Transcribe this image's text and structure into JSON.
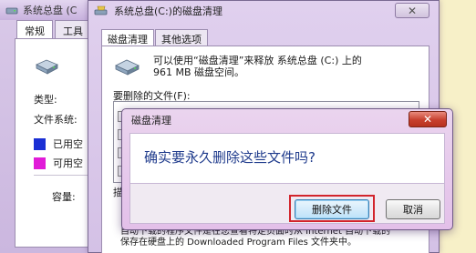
{
  "properties_window": {
    "title": "系统总盘 (C",
    "tabs": [
      {
        "label": "常规",
        "active": true
      },
      {
        "label": "工具",
        "active": false
      }
    ],
    "type_label": "类型:",
    "filesystem_label": "文件系统:",
    "used_label": "已用空",
    "free_label": "可用空",
    "capacity_label": "容量:",
    "used_color": "#1a2fd4",
    "free_color": "#e11bd8"
  },
  "disk_cleanup_window": {
    "title": "系统总盘(C:)的磁盘清理",
    "tabs": [
      {
        "label": "磁盘清理",
        "active": true
      },
      {
        "label": "其他选项",
        "active": false
      }
    ],
    "intro_line1": "可以使用“磁盘清理”来释放 系统总盘 (C:) 上的",
    "intro_line2": "961 MB 磁盘空间。",
    "files_label": "要删除的文件(F):",
    "description_label": "描",
    "description_line1": "自动下载的程序文件是在您查看特定页面时从 Internet 自动下载的",
    "description_line2": "保存在硬盘上的 Downloaded Program Files 文件夹中。",
    "close_glyph": "✕"
  },
  "confirm_dialog": {
    "title": "磁盘清理",
    "question": "确实要永久删除这些文件吗?",
    "delete_button": "删除文件",
    "cancel_button": "取消",
    "close_glyph": "✕",
    "highlight_color": "#d2242c"
  }
}
